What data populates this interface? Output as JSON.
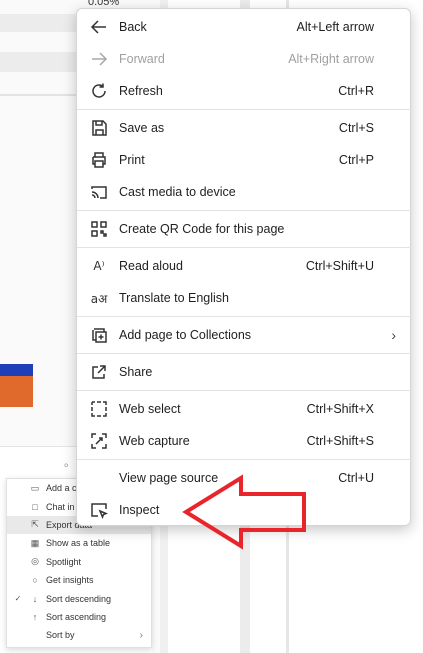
{
  "background": {
    "top_value": "0.05%",
    "mini_menu": [
      {
        "label": "Add a c",
        "icon": "comment-add-icon",
        "check": false,
        "chevron": false,
        "highlighted": false
      },
      {
        "label": "Chat in",
        "icon": "chat-icon",
        "check": false,
        "chevron": false,
        "highlighted": false
      },
      {
        "label": "Export data",
        "icon": "export-icon",
        "check": false,
        "chevron": false,
        "highlighted": true
      },
      {
        "label": "Show as a table",
        "icon": "table-icon",
        "check": false,
        "chevron": false,
        "highlighted": false
      },
      {
        "label": "Spotlight",
        "icon": "spotlight-icon",
        "check": false,
        "chevron": false,
        "highlighted": false
      },
      {
        "label": "Get insights",
        "icon": "lightbulb-icon",
        "check": false,
        "chevron": false,
        "highlighted": false
      },
      {
        "label": "Sort descending",
        "icon": "sort-descending-icon",
        "check": true,
        "chevron": false,
        "highlighted": false
      },
      {
        "label": "Sort ascending",
        "icon": "sort-ascending-icon",
        "check": false,
        "chevron": false,
        "highlighted": false
      },
      {
        "label": "Sort by",
        "icon": "",
        "check": false,
        "chevron": true,
        "highlighted": false
      }
    ]
  },
  "context_menu": {
    "back": {
      "label": "Back",
      "shortcut": "Alt+Left arrow"
    },
    "forward": {
      "label": "Forward",
      "shortcut": "Alt+Right arrow"
    },
    "refresh": {
      "label": "Refresh",
      "shortcut": "Ctrl+R"
    },
    "save_as": {
      "label": "Save as",
      "shortcut": "Ctrl+S"
    },
    "print": {
      "label": "Print",
      "shortcut": "Ctrl+P"
    },
    "cast": {
      "label": "Cast media to device"
    },
    "qr": {
      "label": "Create QR Code for this page"
    },
    "read_aloud": {
      "label": "Read aloud",
      "shortcut": "Ctrl+Shift+U",
      "icon_text": "A⁾"
    },
    "translate": {
      "label": "Translate to English",
      "icon_text": "aअ"
    },
    "collections": {
      "label": "Add page to Collections",
      "chevron": "›"
    },
    "share": {
      "label": "Share"
    },
    "web_select": {
      "label": "Web select",
      "shortcut": "Ctrl+Shift+X"
    },
    "web_capture": {
      "label": "Web capture",
      "shortcut": "Ctrl+Shift+S"
    },
    "view_source": {
      "label": "View page source",
      "shortcut": "Ctrl+U"
    },
    "inspect": {
      "label": "Inspect"
    }
  },
  "colors": {
    "annotation_arrow": "#e8252b",
    "bar_blue": "#1f3fb8",
    "bar_orange": "#e06a2c"
  }
}
